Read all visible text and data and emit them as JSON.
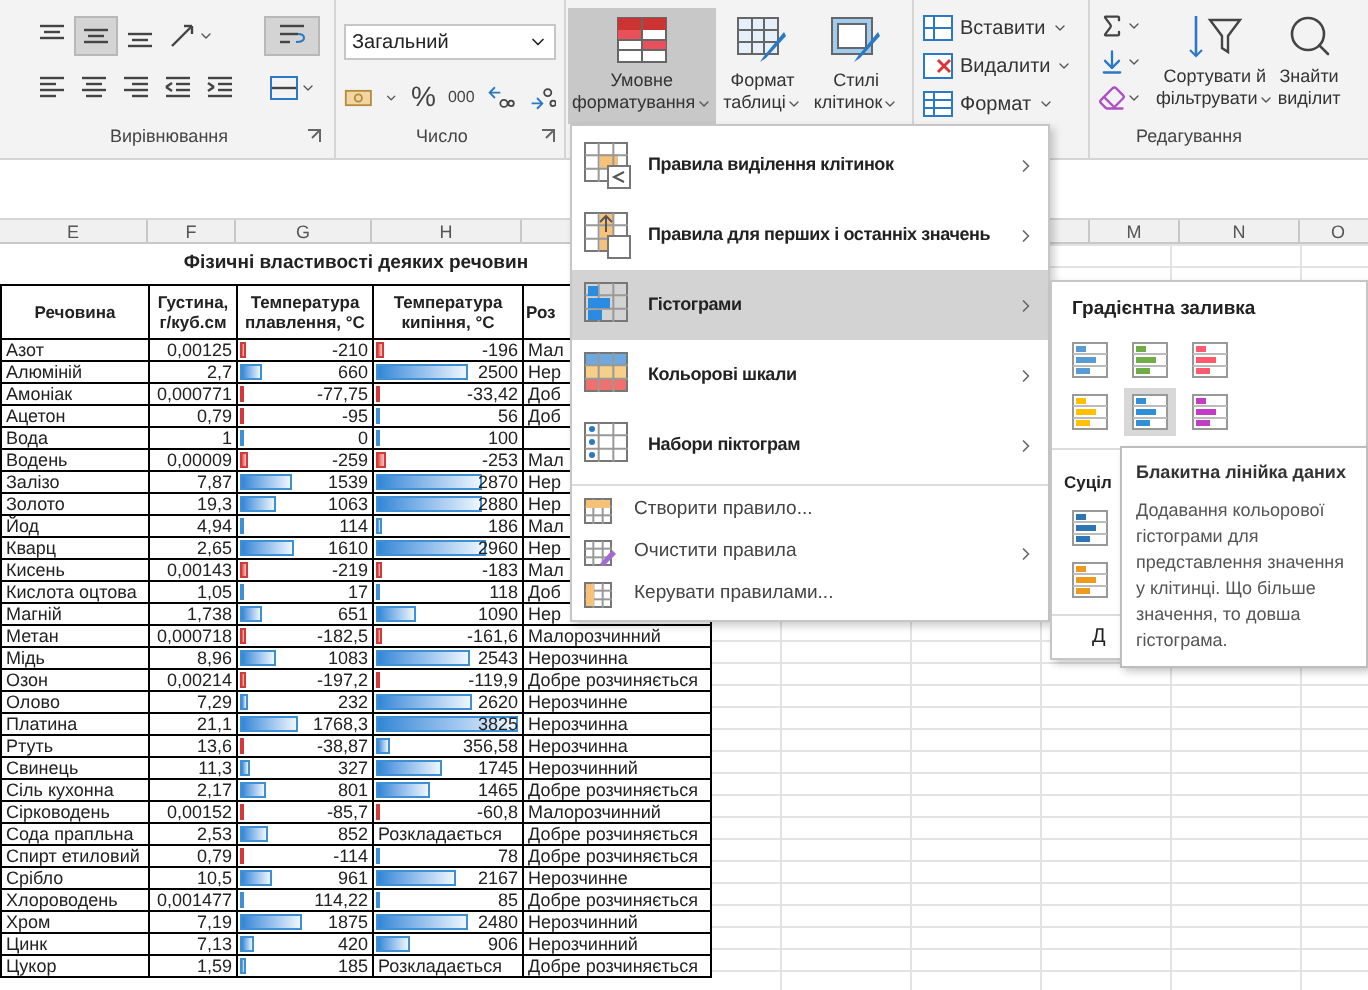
{
  "ribbon": {
    "alignment": {
      "rows": [
        [
          {
            "kind": "top",
            "pressed": false
          },
          {
            "kind": "middle",
            "pressed": true
          },
          {
            "kind": "bottom",
            "pressed": false
          },
          {
            "kind": "orientation",
            "pressed": false
          }
        ],
        [
          {
            "kind": "left",
            "pressed": false
          },
          {
            "kind": "center",
            "pressed": false
          },
          {
            "kind": "right",
            "pressed": false
          },
          {
            "kind": "outdent",
            "pressed": false
          },
          {
            "kind": "indent",
            "pressed": false
          }
        ]
      ],
      "side": [
        {
          "kind": "wrap",
          "pressed": true
        },
        {
          "kind": "merge",
          "pressed": false
        }
      ],
      "label": "Вирівнювання"
    },
    "number": {
      "format": "Загальний",
      "symbols": [
        "%",
        "000"
      ],
      "label": "Число"
    },
    "styles": [
      {
        "kind": "conditional",
        "lines": [
          "Умовне",
          "форматування"
        ],
        "pressed": true
      },
      {
        "kind": "table",
        "lines": [
          "Формат",
          "таблиці"
        ],
        "pressed": false
      },
      {
        "kind": "cell-styles",
        "lines": [
          "Стилі",
          "клітинок"
        ],
        "pressed": false
      }
    ],
    "cells": [
      {
        "kind": "insert",
        "label": "Вставити"
      },
      {
        "kind": "delete",
        "label": "Видалити"
      },
      {
        "kind": "format",
        "label": "Формат"
      }
    ],
    "editing": {
      "buttons": [
        {
          "kind": "sort",
          "lines": [
            "Сортувати й",
            "фільтрувати"
          ]
        },
        {
          "kind": "find",
          "lines": [
            "Знайти",
            "виділит"
          ]
        }
      ],
      "label": "Редагування"
    }
  },
  "sheet": {
    "columns_left": [
      "E",
      "F",
      "G",
      "H"
    ],
    "columns_right": [
      "M",
      "N",
      "O"
    ],
    "title": "Фізичні властивості деяких речовин",
    "headers": [
      "Речовина",
      "Густина, г/куб.см",
      "Температура плавлення, °С",
      "Температура кипіння, °С",
      "Роз"
    ],
    "rows": [
      {
        "name": "Азот",
        "density": "0,00125",
        "melting": {
          "kind": "bar",
          "text": "-210",
          "level": 0.05,
          "negative": true
        },
        "boiling": {
          "kind": "bar",
          "text": "-196",
          "level": 0.05,
          "negative": true
        },
        "solubility": "Мал"
      },
      {
        "name": "Алюміній",
        "density": "2,7",
        "melting": {
          "kind": "bar",
          "text": "660",
          "level": 0.165,
          "negative": false
        },
        "boiling": {
          "kind": "bar",
          "text": "2500",
          "level": 0.625,
          "negative": false
        },
        "solubility": "Нер"
      },
      {
        "name": "Амоніак",
        "density": "0,000771",
        "melting": {
          "kind": "bar",
          "text": "-77,75",
          "level": 0.02,
          "negative": true
        },
        "boiling": {
          "kind": "bar",
          "text": "-33,42",
          "level": 0.015,
          "negative": true
        },
        "solubility": "Доб"
      },
      {
        "name": "Ацетон",
        "density": "0,79",
        "melting": {
          "kind": "bar",
          "text": "-95",
          "level": 0.025,
          "negative": true
        },
        "boiling": {
          "kind": "bar",
          "text": "56",
          "level": 0.015,
          "negative": false
        },
        "solubility": "Доб"
      },
      {
        "name": "Вода",
        "density": "1",
        "melting": {
          "kind": "bar",
          "text": "0",
          "level": 0.015,
          "negative": false
        },
        "boiling": {
          "kind": "bar",
          "text": "100",
          "level": 0.025,
          "negative": false
        }
      },
      {
        "name": "Водень",
        "density": "0,00009",
        "melting": {
          "kind": "bar",
          "text": "-259",
          "level": 0.065,
          "negative": true
        },
        "boiling": {
          "kind": "bar",
          "text": "-253",
          "level": 0.063,
          "negative": true
        },
        "solubility": "Мал"
      },
      {
        "name": "Залізо",
        "density": "7,87",
        "melting": {
          "kind": "bar",
          "text": "1539",
          "level": 0.385,
          "negative": false
        },
        "boiling": {
          "kind": "bar",
          "text": "2870",
          "level": 0.72,
          "negative": false
        },
        "solubility": "Нер"
      },
      {
        "name": "Золото",
        "density": "19,3",
        "melting": {
          "kind": "bar",
          "text": "1063",
          "level": 0.27,
          "negative": false
        },
        "boiling": {
          "kind": "bar",
          "text": "2880",
          "level": 0.72,
          "negative": false
        },
        "solubility": "Нер"
      },
      {
        "name": "Йод",
        "density": "4,94",
        "melting": {
          "kind": "bar",
          "text": "114",
          "level": 0.03,
          "negative": false
        },
        "boiling": {
          "kind": "bar",
          "text": "186",
          "level": 0.047,
          "negative": false
        },
        "solubility": "Мал"
      },
      {
        "name": "Кварц",
        "density": "2,65",
        "melting": {
          "kind": "bar",
          "text": "1610",
          "level": 0.4,
          "negative": false
        },
        "boiling": {
          "kind": "bar",
          "text": "2960",
          "level": 0.74,
          "negative": false
        },
        "solubility": "Нер"
      },
      {
        "name": "Кисень",
        "density": "0,00143",
        "melting": {
          "kind": "bar",
          "text": "-219",
          "level": 0.055,
          "negative": true
        },
        "boiling": {
          "kind": "bar",
          "text": "-183",
          "level": 0.046,
          "negative": true
        },
        "solubility": "Мал"
      },
      {
        "name": "Кислота оцтова",
        "density": "1,05",
        "melting": {
          "kind": "bar",
          "text": "17",
          "level": 0.015,
          "negative": false
        },
        "boiling": {
          "kind": "bar",
          "text": "118",
          "level": 0.03,
          "negative": false
        },
        "solubility": "Доб"
      },
      {
        "name": "Магній",
        "density": "1,738",
        "melting": {
          "kind": "bar",
          "text": "651",
          "level": 0.16,
          "negative": false
        },
        "boiling": {
          "kind": "bar",
          "text": "1090",
          "level": 0.27,
          "negative": false
        },
        "solubility": "Нер"
      },
      {
        "name": "Метан",
        "density": "0,000718",
        "melting": {
          "kind": "bar",
          "text": "-182,5",
          "level": 0.045,
          "negative": true
        },
        "boiling": {
          "kind": "bar",
          "text": "-161,6",
          "level": 0.04,
          "negative": true
        },
        "solubility": "Малорозчинний"
      },
      {
        "name": "Мідь",
        "density": "8,96",
        "melting": {
          "kind": "bar",
          "text": "1083",
          "level": 0.27,
          "negative": false
        },
        "boiling": {
          "kind": "bar",
          "text": "2543",
          "level": 0.64,
          "negative": false
        },
        "solubility": "Нерозчинна"
      },
      {
        "name": "Озон",
        "density": "0,00214",
        "melting": {
          "kind": "bar",
          "text": "-197,2",
          "level": 0.05,
          "negative": true
        },
        "boiling": {
          "kind": "bar",
          "text": "-119,9",
          "level": 0.03,
          "negative": true
        },
        "solubility": "Добре розчиняється"
      },
      {
        "name": "Олово",
        "density": "7,29",
        "melting": {
          "kind": "bar",
          "text": "232",
          "level": 0.06,
          "negative": false
        },
        "boiling": {
          "kind": "bar",
          "text": "2620",
          "level": 0.655,
          "negative": false
        },
        "solubility": "Нерозчинне"
      },
      {
        "name": "Платина",
        "density": "21,1",
        "melting": {
          "kind": "bar",
          "text": "1768,3",
          "level": 0.44,
          "negative": false
        },
        "boiling": {
          "kind": "bar",
          "text": "3825",
          "level": 0.956,
          "negative": false
        },
        "solubility": "Нерозчинна"
      },
      {
        "name": "Ртуть",
        "density": "13,6",
        "melting": {
          "kind": "bar",
          "text": "-38,87",
          "level": 0.015,
          "negative": true
        },
        "boiling": {
          "kind": "bar",
          "text": "356,58",
          "level": 0.09,
          "negative": false
        },
        "solubility": "Нерозчинна"
      },
      {
        "name": "Свинець",
        "density": "11,3",
        "melting": {
          "kind": "bar",
          "text": "327",
          "level": 0.08,
          "negative": false
        },
        "boiling": {
          "kind": "bar",
          "text": "1745",
          "level": 0.44,
          "negative": false
        },
        "solubility": "Нерозчинний"
      },
      {
        "name": "Сіль кухонна",
        "density": "2,17",
        "melting": {
          "kind": "bar",
          "text": "801",
          "level": 0.2,
          "negative": false
        },
        "boiling": {
          "kind": "bar",
          "text": "1465",
          "level": 0.37,
          "negative": false
        },
        "solubility": "Добре розчиняється"
      },
      {
        "name": "Сірководень",
        "density": "0,00152",
        "melting": {
          "kind": "bar",
          "text": "-85,7",
          "level": 0.02,
          "negative": true
        },
        "boiling": {
          "kind": "bar",
          "text": "-60,8",
          "level": 0.015,
          "negative": true
        },
        "solubility": "Малорозчинний"
      },
      {
        "name": "Сода прапльна",
        "density": "2,53",
        "melting": {
          "kind": "bar",
          "text": "852",
          "level": 0.21,
          "negative": false
        },
        "boiling": {
          "kind": "text",
          "text": "Розкладається"
        },
        "solubility": "Добре розчиняється"
      },
      {
        "name": "Спирт етиловий",
        "density": "0,79",
        "melting": {
          "kind": "bar",
          "text": "-114",
          "level": 0.03,
          "negative": true
        },
        "boiling": {
          "kind": "bar",
          "text": "78",
          "level": 0.02,
          "negative": false
        },
        "solubility": "Добре розчиняється"
      },
      {
        "name": "Срібло",
        "density": "10,5",
        "melting": {
          "kind": "bar",
          "text": "961",
          "level": 0.24,
          "negative": false
        },
        "boiling": {
          "kind": "bar",
          "text": "2167",
          "level": 0.54,
          "negative": false
        },
        "solubility": "Нерозчинне"
      },
      {
        "name": "Хлороводень",
        "density": "0,001477",
        "melting": {
          "kind": "bar",
          "text": "114,22",
          "level": 0.03,
          "negative": false
        },
        "boiling": {
          "kind": "bar",
          "text": "85",
          "level": 0.02,
          "negative": false
        },
        "solubility": "Добре розчиняється"
      },
      {
        "name": "Хром",
        "density": "7,19",
        "melting": {
          "kind": "bar",
          "text": "1875",
          "level": 0.47,
          "negative": false
        },
        "boiling": {
          "kind": "bar",
          "text": "2480",
          "level": 0.62,
          "negative": false
        },
        "solubility": "Нерозчинний"
      },
      {
        "name": "Цинк",
        "density": "7,13",
        "melting": {
          "kind": "bar",
          "text": "420",
          "level": 0.1,
          "negative": false
        },
        "boiling": {
          "kind": "bar",
          "text": "906",
          "level": 0.23,
          "negative": false
        },
        "solubility": "Нерозчинний"
      },
      {
        "name": "Цукор",
        "density": "1,59",
        "melting": {
          "kind": "bar",
          "text": "185",
          "level": 0.05,
          "negative": false
        },
        "boiling": {
          "kind": "text",
          "text": "Розкладається"
        },
        "solubility": "Добре розчиняється"
      }
    ]
  },
  "menu": {
    "items": [
      {
        "kind": "highlight",
        "label": "Правила виділення клітинок",
        "selected": false
      },
      {
        "kind": "top-bottom",
        "label": "Правила для перших і останніх значень",
        "selected": false
      },
      {
        "kind": "data-bars",
        "label": "Гістограми",
        "selected": true
      },
      {
        "kind": "color-scales",
        "label": "Кольорові шкали",
        "selected": false
      },
      {
        "kind": "icon-sets",
        "label": "Набори піктограм",
        "selected": false
      }
    ],
    "actions": [
      {
        "kind": "new",
        "label": "Створити правило...",
        "has_submenu": false
      },
      {
        "kind": "clear",
        "label": "Очистити правила",
        "has_submenu": true
      },
      {
        "kind": "manage",
        "label": "Керувати правилами...",
        "has_submenu": false
      }
    ]
  },
  "submenu": {
    "gradient_title": "Градієнтна заливка",
    "gradient": [
      {
        "color": "#5b9bd5",
        "selected": false
      },
      {
        "color": "#70ad47",
        "selected": false
      },
      {
        "color": "#ff5a6e",
        "selected": false
      },
      {
        "color": "#ffc000",
        "selected": false
      },
      {
        "color": "#2f8fd8",
        "selected": true
      },
      {
        "color": "#c43bc4",
        "selected": false
      }
    ],
    "solid_title": "Суціл",
    "solid": [
      {
        "color": "#2e75b6"
      },
      {
        "color": "#ed9b1f"
      }
    ],
    "more": "Д"
  },
  "tooltip": {
    "title": "Блакитна лінійка даних",
    "text": "Додавання кольорової гістограми для представлення значення у клітинці. Що більше значення, то довша гістограма."
  }
}
